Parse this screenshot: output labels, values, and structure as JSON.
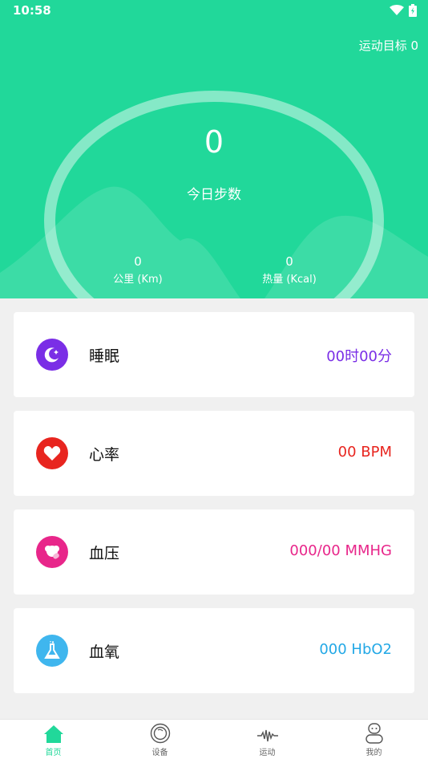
{
  "status_bar": {
    "time": "10:58"
  },
  "header": {
    "goal_label": "运动目标 0",
    "steps_value": "0",
    "steps_label": "今日步数",
    "distance": {
      "value": "0",
      "label": "公里 (Km)"
    },
    "calories": {
      "value": "0",
      "label": "热量 (Kcal)"
    },
    "color": "#21d89a"
  },
  "cards": [
    {
      "name": "睡眠",
      "value": "00时00分",
      "icon": "moon-icon",
      "color": "#7a2ee6"
    },
    {
      "name": "心率",
      "value": "00 BPM",
      "icon": "heart-icon",
      "color": "#e8251f"
    },
    {
      "name": "血压",
      "value": "000/00 MMHG",
      "icon": "blood-pressure-icon",
      "color": "#e8268a"
    },
    {
      "name": "血氧",
      "value": "000 HbO2",
      "icon": "flask-icon",
      "color": "#22a8e6"
    }
  ],
  "nav": [
    {
      "label": "首页",
      "icon": "home-icon",
      "active": true
    },
    {
      "label": "设备",
      "icon": "device-icon",
      "active": false
    },
    {
      "label": "运动",
      "icon": "activity-icon",
      "active": false
    },
    {
      "label": "我的",
      "icon": "profile-icon",
      "active": false
    }
  ]
}
